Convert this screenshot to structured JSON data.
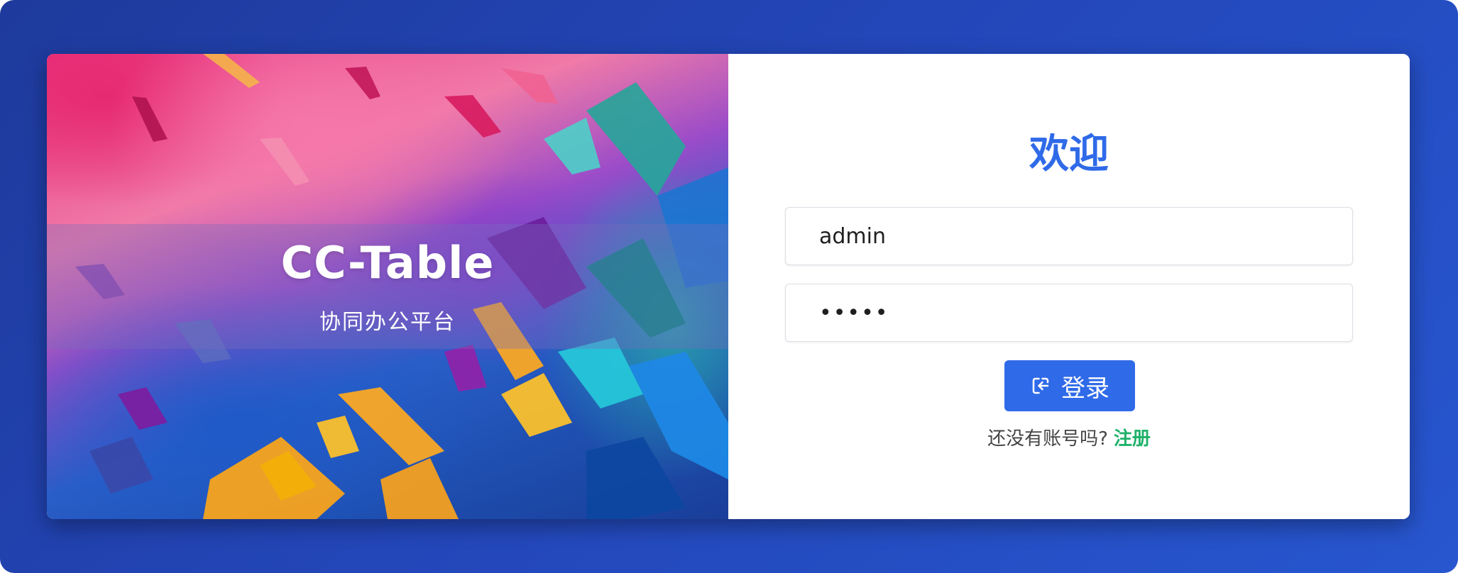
{
  "colors": {
    "background": "#2346b8",
    "accent": "#2f6ae8",
    "link": "#1fb26b",
    "card": "#ffffff"
  },
  "brand": {
    "title": "CC-Table",
    "subtitle": "协同办公平台"
  },
  "login": {
    "heading": "欢迎",
    "username_value": "admin",
    "password_value": "admin",
    "submit_label": "登录",
    "submit_icon": "login-enter-icon",
    "register_prompt": "还没有账号吗?",
    "register_link": "注册"
  }
}
